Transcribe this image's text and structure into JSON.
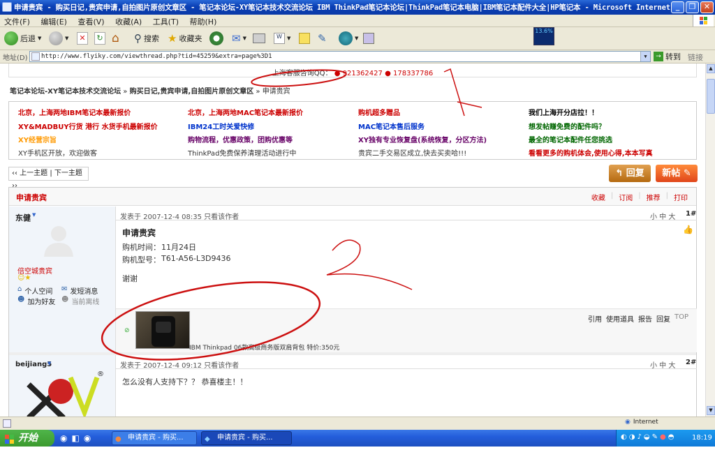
{
  "window": {
    "title": "申请贵宾 - 购买日记,贵宾申请,自拍图片原创文章区 - 笔记本论坛-XY笔记本技术交流论坛 IBM ThinkPad笔记本论坛|ThinkPad笔记本电脑|IBM笔记本配件大全|HP笔记本 - Microsoft Internet Explorer",
    "minimize": "_",
    "restore": "❐",
    "close": "✕"
  },
  "menu": [
    "文件(F)",
    "编辑(E)",
    "查看(V)",
    "收藏(A)",
    "工具(T)",
    "帮助(H)"
  ],
  "toolbar": {
    "back": "后退",
    "search": "搜索",
    "favorites": "收藏夹",
    "cpu_badge": "13.6%"
  },
  "address": {
    "label": "地址(D)",
    "url": "http://www.flyiky.com/viewthread.php?tid=45259&extra=page%3D1",
    "go": "转到",
    "links": "链接"
  },
  "forum": {
    "top_contact_prefix": "上海客服咨询QQ：",
    "qq1": "921362427",
    "qq2": "178337786",
    "breadcrumb": [
      "笔记本论坛-XY笔记本技术交流论坛",
      "购买日记,贵宾申请,自拍图片原创文章区",
      "申请贵宾"
    ],
    "links": [
      [
        "北京，上海两地IBM笔记本最新报价",
        "北京，上海两地MAC笔记本最新报价",
        "购机超多赠品",
        "我们上海开分店拉！！"
      ],
      [
        "XY&MADBUY行货 港行 水货手机最新报价",
        "IBM24工时关爱快修",
        "MAC笔记本售后服务",
        "想发帖赚免费的配件吗？"
      ],
      [
        "XY经营宗旨",
        "购物流程，优惠政策，团购优惠等",
        "XY独有专业恢复盘(系统恢复，分区方法)",
        "最全的笔记本配件任您挑选"
      ],
      [
        "XY手机区开放，欢迎做客",
        "ThinkPad免费保养清理活动进行中",
        "贵宾二手交易区成立,快去买卖哈!!!",
        "看看更多的购机体会,使用心得,本本写真"
      ]
    ],
    "prev_next": "‹‹ 上一主题 | 下一主题 ››",
    "reply_btn": "回复",
    "new_btn": "新帖",
    "thread_title": "申请贵宾",
    "thread_actions": [
      "收藏",
      "订阅",
      "推荐",
      "打印"
    ]
  },
  "post1": {
    "author": "东健",
    "group": "倍空城贵宾",
    "side_links": [
      "个人空间",
      "发短消息",
      "加为好友",
      "当前离线"
    ],
    "meta": "发表于 2007-12-4 08:35  只看该作者",
    "fontsize": "小 中 大",
    "floor": "1#",
    "title": "申请贵宾",
    "line1_label": "购机时间：",
    "line1_value": "11月24日",
    "line2_label": "购机型号：",
    "line2_value": "T61-A56-L3D9436",
    "thanks": "谢谢",
    "attach_caption": "IBM Thinkpad 06款高级商务版双肩背包  特价:350元",
    "post_actions": [
      "引用",
      "使用道具",
      "报告",
      "回复",
      "TOP"
    ]
  },
  "post2": {
    "author": "beijiang5",
    "meta": "发表于 2007-12-4 09:12  只看该作者",
    "fontsize": "小 中 大",
    "floor": "2#",
    "body": "怎么没有人支持下？？  恭喜楼主！！",
    "avatar_reg": "®"
  },
  "annotations": {
    "mark1": "1",
    "mark2": "2"
  },
  "statusbar": {
    "zone": "Internet"
  },
  "taskbar": {
    "start": "开始",
    "tasks": [
      "申请贵宾 - 购买...",
      "申请贵宾 - 购买..."
    ],
    "clock": "18:19"
  },
  "colors": {
    "title_blue": "#0a3fb4",
    "link_red": "#cc0000",
    "link_blue": "#0033cc",
    "link_green": "#006600",
    "link_orange": "#ff9900",
    "taskbar_blue": "#245edb",
    "start_green": "#3c9a2e",
    "annotation_red": "#cc1010"
  }
}
